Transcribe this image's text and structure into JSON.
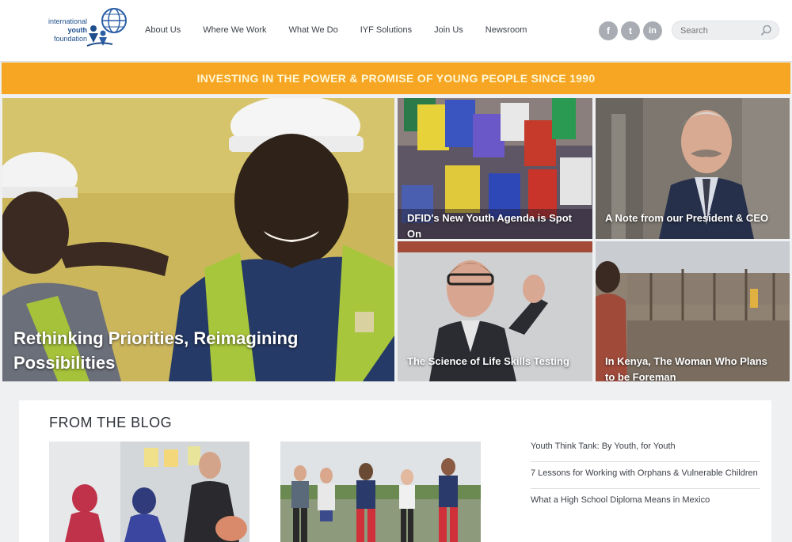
{
  "logo": {
    "line1": "international",
    "line2": "youth",
    "line3": "foundation"
  },
  "nav": {
    "items": [
      "About Us",
      "Where We Work",
      "What We Do",
      "IYF Solutions",
      "Join Us",
      "Newsroom"
    ]
  },
  "social": {
    "facebook": "f",
    "twitter": "t",
    "linkedin": "in"
  },
  "search": {
    "placeholder": "Search"
  },
  "banner": {
    "text": "INVESTING IN THE POWER & PROMISE OF YOUNG PEOPLE SINCE 1990"
  },
  "tiles": {
    "main": "Rethinking Priorities, Reimagining Possibilities",
    "t1": "DFID's New Youth Agenda is Spot On",
    "t2": "A Note from our President & CEO",
    "t3": "The Science of Life Skills Testing",
    "t4": "In Kenya, The Woman Who Plans to be Foreman"
  },
  "blog": {
    "title": "FROM THE BLOG",
    "links": [
      "Youth Think Tank: By Youth, for Youth",
      "7 Lessons for Working with Orphans & Vulnerable Children",
      "What a High School Diploma Means in Mexico"
    ]
  },
  "colors": {
    "banner": "#f6a623",
    "brand_blue": "#1f4e8c"
  }
}
